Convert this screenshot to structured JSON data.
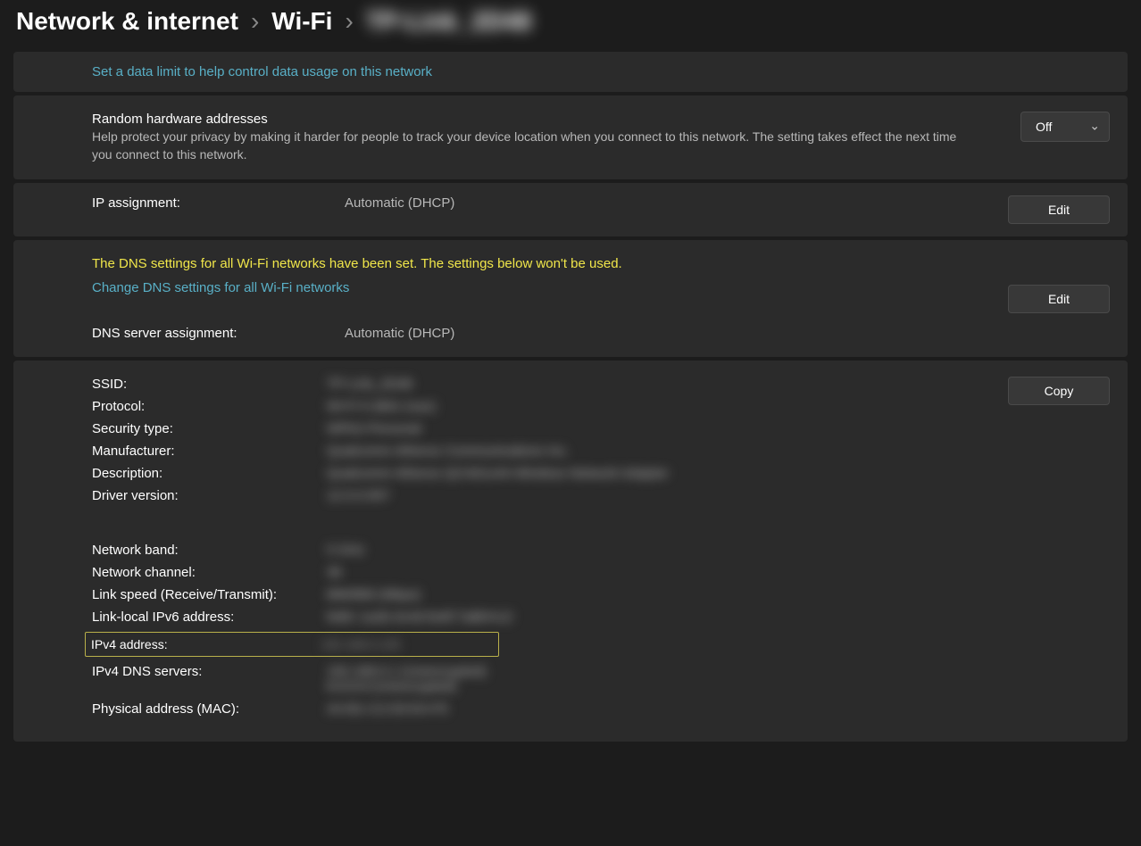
{
  "breadcrumb": {
    "root": "Network & internet",
    "level1": "Wi-Fi",
    "level2": "TP-Link_2D48"
  },
  "data_limit": {
    "link_text": "Set a data limit to help control data usage on this network"
  },
  "random_hw": {
    "title": "Random hardware addresses",
    "subtitle": "Help protect your privacy by making it harder for people to track your device location when you connect to this network. The setting takes effect the next time you connect to this network.",
    "value": "Off"
  },
  "ip_assign": {
    "label": "IP assignment:",
    "value": "Automatic (DHCP)",
    "button": "Edit"
  },
  "dns": {
    "warning": "The DNS settings for all Wi-Fi networks have been set. The settings below won't be used.",
    "change_link": "Change DNS settings for all Wi-Fi networks",
    "label": "DNS server assignment:",
    "value": "Automatic (DHCP)",
    "button": "Edit"
  },
  "details": {
    "copy_button": "Copy",
    "rows1": [
      {
        "label": "SSID:",
        "value": "TP-Link_2D48"
      },
      {
        "label": "Protocol:",
        "value": "Wi-Fi 5 (802.11ac)"
      },
      {
        "label": "Security type:",
        "value": "WPA2-Personal"
      },
      {
        "label": "Manufacturer:",
        "value": "Qualcomm Atheros Communications Inc."
      },
      {
        "label": "Description:",
        "value": "Qualcomm Atheros QCA61x4A Wireless Network Adapter"
      },
      {
        "label": "Driver version:",
        "value": "12.0.0.957"
      }
    ],
    "rows2": [
      {
        "label": "Network band:",
        "value": "5 GHz"
      },
      {
        "label": "Network channel:",
        "value": "36"
      },
      {
        "label": "Link speed (Receive/Transmit):",
        "value": "866/866 (Mbps)"
      },
      {
        "label": "Link-local IPv6 address:",
        "value": "fe80::1a2b:3c4d:5e6f:7a8b%12"
      }
    ],
    "ipv4_row": {
      "label": "IPv4 address:",
      "value": "192.168.0.105"
    },
    "rows3": [
      {
        "label": "IPv4 DNS servers:",
        "value": "192.168.0.1 (Unencrypted)\n8.8.8.8 (Unencrypted)"
      },
      {
        "label": "Physical address (MAC):",
        "value": "A4-B1-C2-D3-E4-F5"
      }
    ]
  }
}
